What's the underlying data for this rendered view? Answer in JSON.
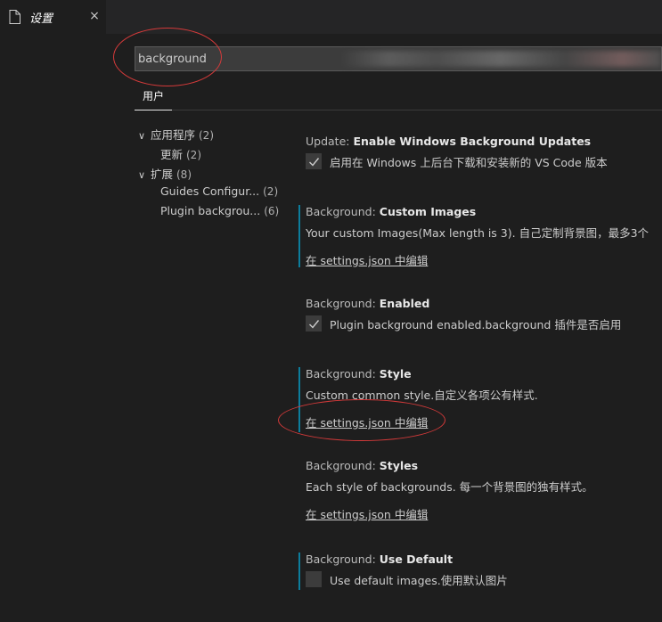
{
  "tab": {
    "title": "设置",
    "close": "×",
    "icon": "file-icon"
  },
  "search": {
    "value": "background",
    "placeholder": ""
  },
  "scope": {
    "tab_label": "用户"
  },
  "toc": [
    {
      "label": "应用程序",
      "count": "(2)",
      "expanded": true
    },
    {
      "label": "更新",
      "count": "(2)"
    },
    {
      "label": "扩展",
      "count": "(8)",
      "expanded": true
    },
    {
      "label": "Guides Configur...",
      "count": "(2)"
    },
    {
      "label": "Plugin backgrou...",
      "count": "(6)"
    }
  ],
  "settings": [
    {
      "category": "Update: ",
      "name": "Enable Windows Background Updates",
      "description": "启用在 Windows 上后台下载和安装新的 VS Code 版本",
      "checked": true
    },
    {
      "category": "Background: ",
      "name": "Custom Images",
      "description": "Your custom Images(Max length is 3). 自己定制背景图，最多3个",
      "link": "在 settings.json 中编辑"
    },
    {
      "category": "Background: ",
      "name": "Enabled",
      "description": "Plugin background enabled.background 插件是否启用",
      "checked": true
    },
    {
      "category": "Background: ",
      "name": "Style",
      "description": "Custom common style.自定义各项公有样式.",
      "link": "在 settings.json 中编辑"
    },
    {
      "category": "Background: ",
      "name": "Styles",
      "description": "Each style of backgrounds. 每一个背景图的独有样式。",
      "link": "在 settings.json 中编辑"
    },
    {
      "category": "Background: ",
      "name": "Use Default",
      "description": "Use default images.使用默认图片",
      "checked": false
    }
  ],
  "colors": {
    "accent_modified": "#0c7d9d",
    "annotation": "#d43a3a",
    "background": "#1e1e1e"
  }
}
